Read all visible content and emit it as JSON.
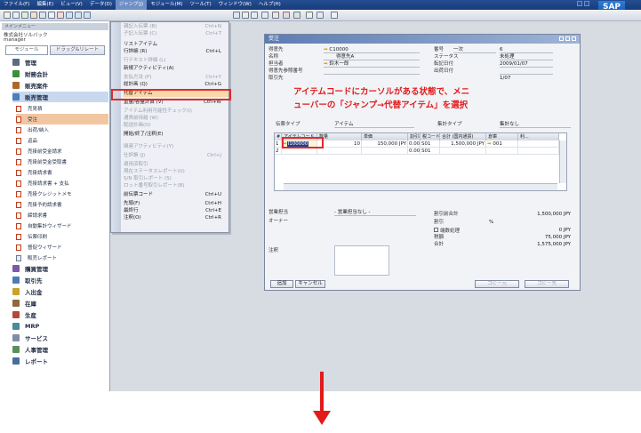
{
  "menubar": {
    "items": [
      "ファイル(F)",
      "編集(E)",
      "ビュー(V)",
      "データ(D)",
      "ジャンプ(J)",
      "モジュール(M)",
      "ツール(T)",
      "ウィンドウ(W)",
      "ヘルプ(H)"
    ]
  },
  "brand": {
    "logo_text": "SAP"
  },
  "sidebar": {
    "header": "メインメニュー",
    "company": "株式会社ソルバック",
    "user": "manager",
    "tabs": [
      "モジュール",
      "ドラッグ&リレート"
    ],
    "items": [
      {
        "label": "管理",
        "color": "#5b6b86"
      },
      {
        "label": "財務会計",
        "color": "#3d8e3d"
      },
      {
        "label": "販売案件",
        "color": "#b0682a"
      },
      {
        "label": "販売管理",
        "color": "#4b7dbf"
      }
    ],
    "sub_items": [
      "売見積",
      "受注",
      "出荷/納入",
      "返品",
      "売掛前受金請求",
      "売掛前受金受取書",
      "売掛請求書",
      "売掛請求書 + 支払",
      "売掛クレジットメモ",
      "売掛予約請求書",
      "締請求書",
      "自動集計ウィザード",
      "伝票印刷",
      "督促ウィザード",
      "販売レポート"
    ],
    "modules": [
      "購買管理",
      "取引先",
      "入出金",
      "在庫",
      "生産",
      "MRP",
      "サービス",
      "人事管理",
      "レポート"
    ]
  },
  "dropdown": {
    "rows": [
      {
        "label": "親記入伝票 (B)",
        "key": "Ctrl+N",
        "enabled": false
      },
      {
        "label": "子記入伝票 (C)",
        "key": "Ctrl+T",
        "enabled": false
      },
      {
        "label": "リストアイテム",
        "key": "",
        "enabled": true
      },
      {
        "label": "行詳細 (R)",
        "key": "Ctrl+L",
        "enabled": true
      },
      {
        "label": "行テキスト詳細 (L)",
        "key": "",
        "enabled": false
      },
      {
        "label": "新規アクティビティ(A)",
        "key": "",
        "enabled": true
      },
      {
        "label": "支払方法 (P)",
        "key": "Ctrl+Y",
        "enabled": false
      },
      {
        "label": "総計画 (Q)",
        "key": "Ctrl+G",
        "enabled": true
      },
      {
        "label": "代替アイテム",
        "key": "",
        "enabled": true,
        "highlight": true
      },
      {
        "label": "重量/容量計算 (V)",
        "key": "Ctrl+W",
        "enabled": true
      },
      {
        "label": "アイテム利用可能性チェック(I)",
        "key": "",
        "enabled": false
      },
      {
        "label": "通貨前持越 (W)",
        "key": "",
        "enabled": false
      },
      {
        "label": "配送計画(O)",
        "key": "",
        "enabled": false
      },
      {
        "label": "開始/終了/注釈(E)",
        "key": "",
        "enabled": true
      },
      {
        "label": "関連アクティビティ(Y)",
        "key": "",
        "enabled": false
      },
      {
        "label": "仕訳帳 (J)",
        "key": "Ctrl+J",
        "enabled": false
      },
      {
        "label": "適用済取引",
        "key": "",
        "enabled": false
      },
      {
        "label": "現在ステータスレポート(U)",
        "key": "",
        "enabled": false
      },
      {
        "label": "S/N 取引レポート (S)",
        "key": "",
        "enabled": false
      },
      {
        "label": "ロット番号取引レポート(B)",
        "key": "",
        "enabled": false
      },
      {
        "label": "前伝票コード",
        "key": "Ctrl+U",
        "enabled": true
      },
      {
        "label": "先頭(F)",
        "key": "Ctrl+H",
        "enabled": true
      },
      {
        "label": "最終行",
        "key": "Ctrl+E",
        "enabled": true
      },
      {
        "label": "注釈(O)",
        "key": "Ctrl+R",
        "enabled": true
      }
    ]
  },
  "order_window": {
    "title": "受注",
    "left_fields": [
      {
        "label": "得意先",
        "value": "C10000",
        "arrow": true
      },
      {
        "label": "名称",
        "value": "得意先A",
        "arrow": false
      },
      {
        "label": "担当者",
        "value": "鈴木一郎",
        "arrow": true
      },
      {
        "label": "得意先参照番号",
        "value": "",
        "arrow": false
      },
      {
        "label": "取引先",
        "value": "",
        "arrow": false
      }
    ],
    "right_fields": [
      {
        "label": "番号",
        "value": "一次",
        "value2": "6"
      },
      {
        "label": "ステータス",
        "value": "",
        "value2": "未処理"
      },
      {
        "label": "転記日付",
        "value": "",
        "value2": "2009/01/07"
      },
      {
        "label": "出荷日付",
        "value": "",
        "value2": ""
      },
      {
        "label": "",
        "value": "",
        "value2": "1/07"
      }
    ],
    "tabs_row": {
      "type_label": "伝票タイプ",
      "type_value": "アイテム",
      "summary_label": "集計タイプ",
      "summary_value": "集計なし"
    },
    "grid": {
      "columns": [
        "#",
        "アイテムコード",
        "数量",
        "単価",
        "割引率",
        "税コード",
        "合計 (国内通貨)",
        "倉庫",
        "利..."
      ],
      "rows": [
        [
          "1",
          "I100000",
          "10",
          "150,000 JPY",
          "0.00",
          "S01",
          "1,500,000 JPY",
          "001",
          ""
        ],
        [
          "2",
          "",
          "",
          "",
          "0.00",
          "S01",
          "",
          "",
          ""
        ]
      ]
    },
    "bottom_left": [
      {
        "label": "営業担当",
        "value": "- 営業担当なし -"
      },
      {
        "label": "オーナー",
        "value": ""
      },
      {
        "label": "注釈",
        "value": ""
      }
    ],
    "totals": [
      {
        "label": "割引前合計",
        "value": "1,500,000 JPY"
      },
      {
        "label": "割引",
        "value": "%"
      },
      {
        "label": "端数処理",
        "value": "0 JPY"
      },
      {
        "label": "税額",
        "value": "75,000 JPY"
      },
      {
        "label": "合計",
        "value": "1,575,000 JPY"
      }
    ],
    "buttons": {
      "add": "追加",
      "cancel": "キャンセル",
      "copy_from": "コピー元",
      "copy_to": "コピー先"
    }
  },
  "callout": {
    "line1": "アイテムコードにカーソルがある状態で、メニ",
    "line2": "ューバーの「ジャンプ→代替アイテム」を選択"
  },
  "colors": {
    "accent_red": "#e21a1a",
    "menubar": "#1f4686",
    "highlight_item": "#f9d7a8"
  }
}
